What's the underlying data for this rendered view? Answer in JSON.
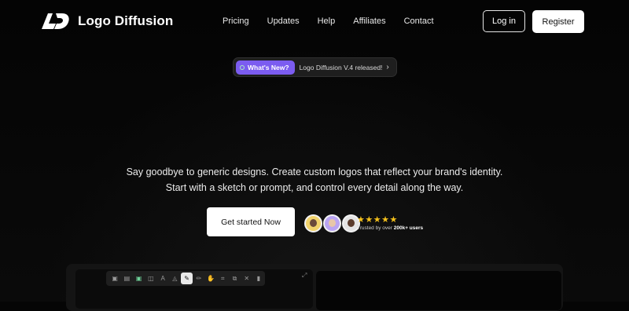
{
  "brand": {
    "name": "Logo Diffusion",
    "logo_icon": "ld-monogram-icon"
  },
  "nav": {
    "items": [
      "Pricing",
      "Updates",
      "Help",
      "Affiliates",
      "Contact"
    ]
  },
  "auth": {
    "login_label": "Log in",
    "register_label": "Register"
  },
  "announcement": {
    "badge": "What's New?",
    "text": "Logo Diffusion V.4 released!",
    "chevron": "›"
  },
  "hero": {
    "line1": "Say goodbye to generic designs. Create custom logos that reflect your brand's identity.",
    "line2": "Start with a sketch or prompt, and control every detail along the way.",
    "cta_label": "Get started  Now"
  },
  "social_proof": {
    "stars": "★★★★★",
    "rating": 5,
    "trusted_prefix": "Trusted by over ",
    "trusted_count": "200k+ users"
  },
  "editor_preview": {
    "tools": [
      "image-icon",
      "gallery-icon",
      "photo-icon",
      "layers-icon",
      "text-icon",
      "pen-icon",
      "pencil-icon",
      "hand-icon",
      "crop-icon",
      "copy-icon",
      "close-icon",
      "trash-icon"
    ],
    "active_tool": "pen-icon"
  },
  "colors": {
    "accent": "#7b5cf0",
    "star": "#f6c21c",
    "background": "#050505"
  }
}
